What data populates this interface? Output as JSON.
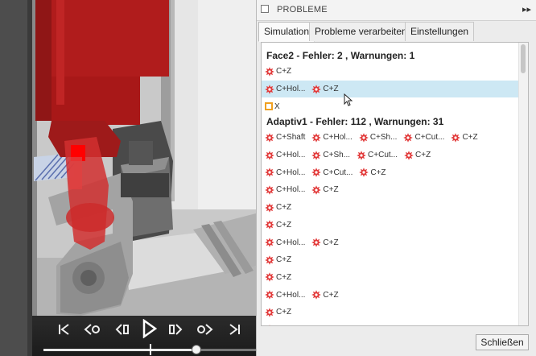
{
  "panel": {
    "title": "PROBLEME",
    "expand_glyph": "▸▸",
    "tabs": [
      {
        "label": "Simulation",
        "active": true
      },
      {
        "label": "Probleme verarbeiten",
        "active": false
      },
      {
        "label": "Einstellungen",
        "active": false
      }
    ],
    "close_label": "Schließen"
  },
  "groups": [
    {
      "name": "Face2",
      "summary": " - Fehler: 2 , Warnungen: 1",
      "rows": [
        {
          "selected": false,
          "items": [
            {
              "type": "error",
              "label": "C+Z"
            }
          ]
        },
        {
          "selected": true,
          "items": [
            {
              "type": "error",
              "label": "C+Hol..."
            },
            {
              "type": "error",
              "label": "C+Z"
            }
          ]
        },
        {
          "selected": false,
          "items": [
            {
              "type": "warning",
              "label": "X"
            }
          ]
        }
      ]
    },
    {
      "name": "Adaptiv1",
      "summary": " - Fehler: 112 , Warnungen: 31",
      "rows": [
        {
          "selected": false,
          "items": [
            {
              "type": "error",
              "label": "C+Shaft"
            },
            {
              "type": "error",
              "label": "C+Hol..."
            },
            {
              "type": "error",
              "label": "C+Sh..."
            },
            {
              "type": "error",
              "label": "C+Cut..."
            },
            {
              "type": "error",
              "label": "C+Z"
            }
          ]
        },
        {
          "selected": false,
          "items": [
            {
              "type": "error",
              "label": "C+Hol..."
            },
            {
              "type": "error",
              "label": "C+Sh..."
            },
            {
              "type": "error",
              "label": "C+Cut..."
            },
            {
              "type": "error",
              "label": "C+Z"
            }
          ]
        },
        {
          "selected": false,
          "items": [
            {
              "type": "error",
              "label": "C+Hol..."
            },
            {
              "type": "error",
              "label": "C+Cut..."
            },
            {
              "type": "error",
              "label": "C+Z"
            }
          ]
        },
        {
          "selected": false,
          "items": [
            {
              "type": "error",
              "label": "C+Hol..."
            },
            {
              "type": "error",
              "label": "C+Z"
            }
          ]
        },
        {
          "selected": false,
          "items": [
            {
              "type": "error",
              "label": "C+Z"
            }
          ]
        },
        {
          "selected": false,
          "items": [
            {
              "type": "error",
              "label": "C+Z"
            }
          ]
        },
        {
          "selected": false,
          "items": [
            {
              "type": "error",
              "label": "C+Hol..."
            },
            {
              "type": "error",
              "label": "C+Z"
            }
          ]
        },
        {
          "selected": false,
          "items": [
            {
              "type": "error",
              "label": "C+Z"
            }
          ]
        },
        {
          "selected": false,
          "items": [
            {
              "type": "error",
              "label": "C+Z"
            }
          ]
        },
        {
          "selected": false,
          "items": [
            {
              "type": "error",
              "label": "C+Hol..."
            },
            {
              "type": "error",
              "label": "C+Z"
            }
          ]
        },
        {
          "selected": false,
          "items": [
            {
              "type": "error",
              "label": "C+Z"
            }
          ]
        },
        {
          "selected": false,
          "items": [
            {
              "type": "error",
              "label": ""
            }
          ]
        }
      ]
    }
  ],
  "playback": {
    "controls": [
      "skip-to-start-icon",
      "previous-operation-icon",
      "step-back-icon",
      "play-icon",
      "step-forward-icon",
      "next-operation-icon",
      "skip-to-end-icon"
    ],
    "progress_fraction": 0.72
  },
  "colors": {
    "error": "#e23b3b",
    "warning": "#f0a020",
    "selection": "#cde8f4",
    "collision": "#c41414"
  }
}
